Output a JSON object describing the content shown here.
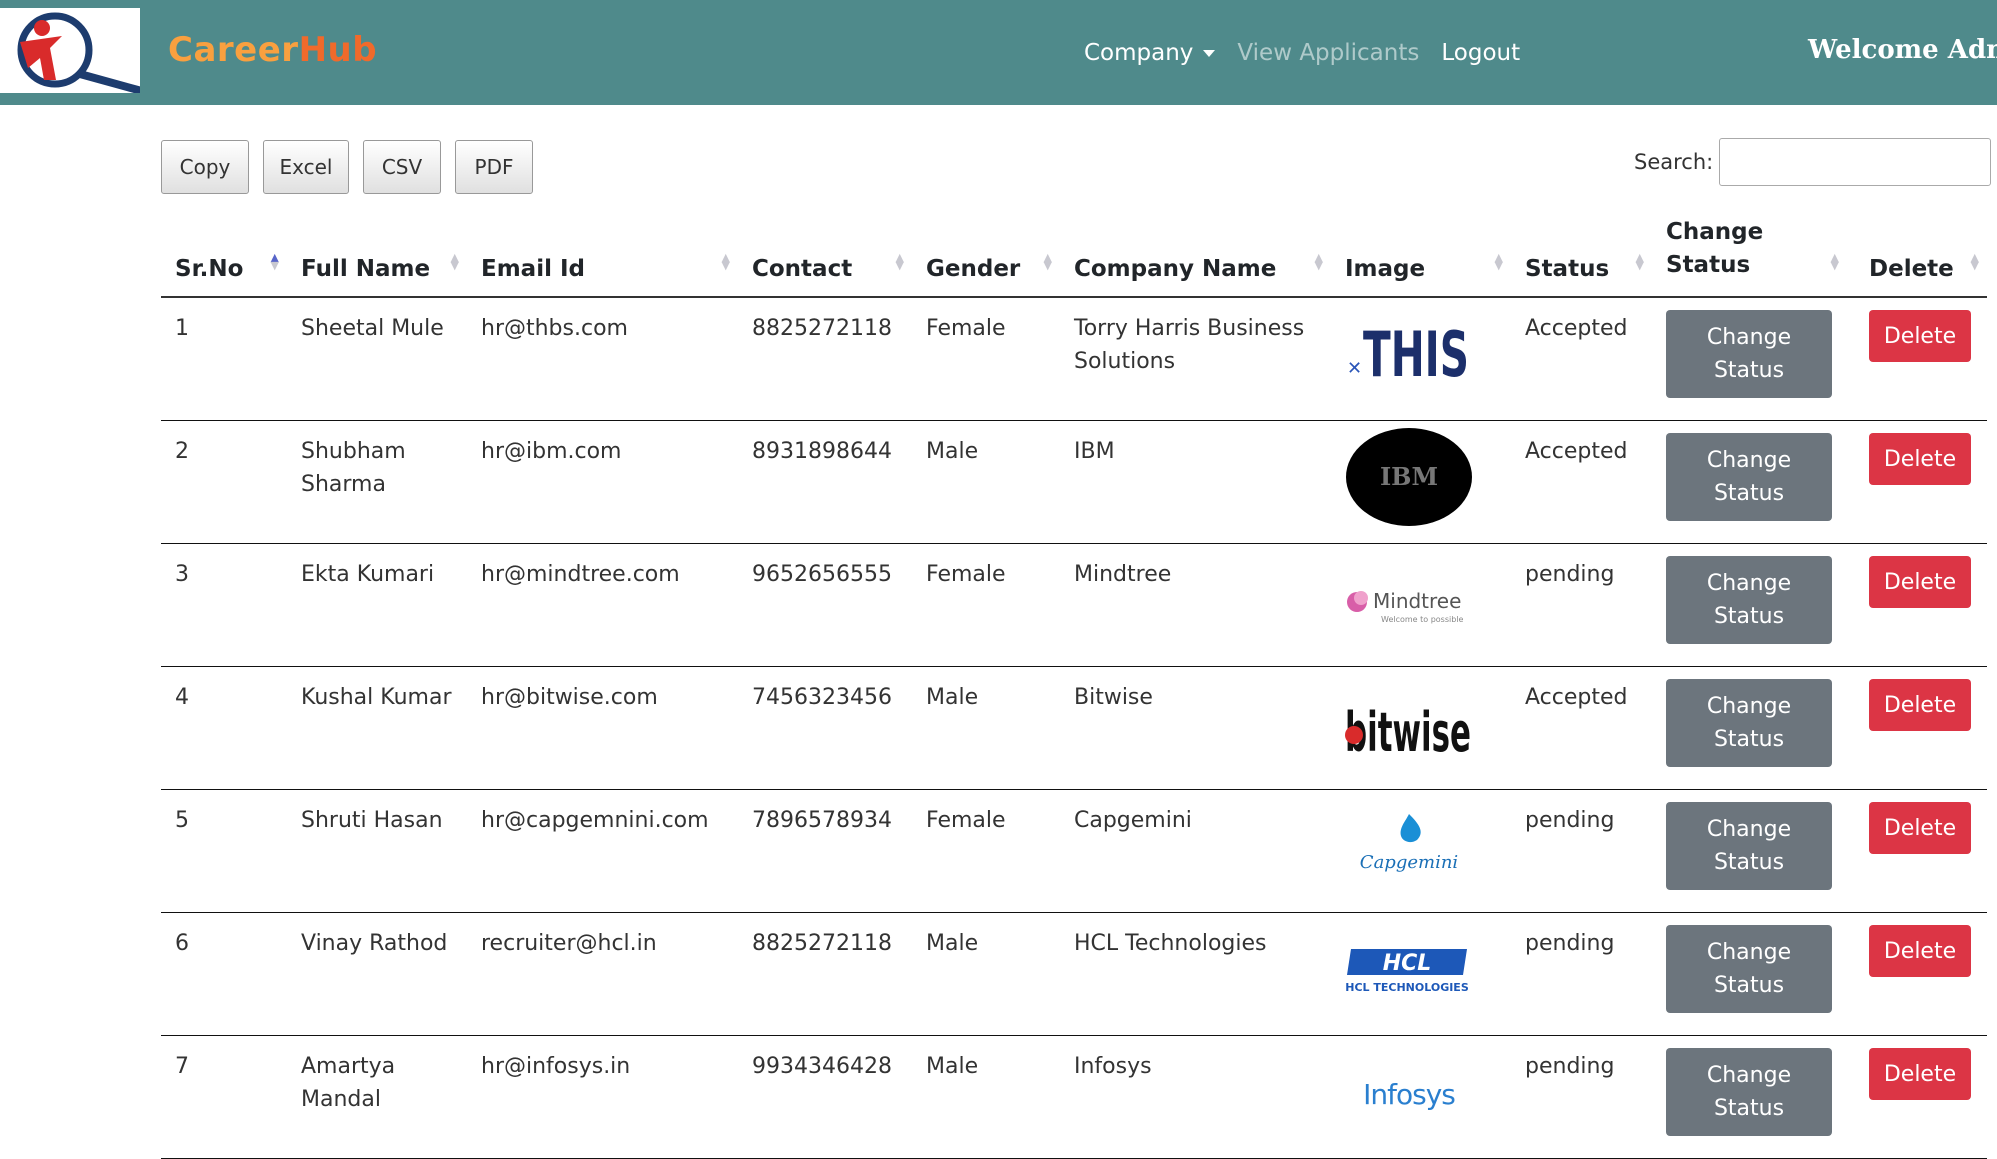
{
  "navbar": {
    "brand_part1": "Career",
    "brand_part2": "Hub",
    "links": [
      "Company",
      "View Applicants",
      "Logout"
    ],
    "welcome": "Welcome Admin"
  },
  "toolbar": {
    "buttons": [
      "Copy",
      "Excel",
      "CSV",
      "PDF"
    ]
  },
  "search": {
    "label": "Search:",
    "value": ""
  },
  "table": {
    "headers": [
      "Sr.No",
      "Full Name",
      "Email Id",
      "Contact",
      "Gender",
      "Company Name",
      "Image",
      "Status",
      "Change Status",
      "Delete"
    ],
    "change_status_label": "Change Status",
    "delete_label": "Delete",
    "rows": [
      {
        "sr": "1",
        "name": "Sheetal Mule",
        "email": "hr@thbs.com",
        "contact": "8825272118",
        "gender": "Female",
        "company": "Torry Harris Business Solutions",
        "logo": "thbs-logo",
        "status": "Accepted"
      },
      {
        "sr": "2",
        "name": "Shubham Sharma",
        "email": "hr@ibm.com",
        "contact": "8931898644",
        "gender": "Male",
        "company": "IBM",
        "logo": "ibm-logo",
        "status": "Accepted"
      },
      {
        "sr": "3",
        "name": "Ekta Kumari",
        "email": "hr@mindtree.com",
        "contact": "9652656555",
        "gender": "Female",
        "company": "Mindtree",
        "logo": "mindtree-logo",
        "status": "pending"
      },
      {
        "sr": "4",
        "name": "Kushal Kumar",
        "email": "hr@bitwise.com",
        "contact": "7456323456",
        "gender": "Male",
        "company": "Bitwise",
        "logo": "bitwise-logo",
        "status": "Accepted"
      },
      {
        "sr": "5",
        "name": "Shruti Hasan",
        "email": "hr@capgemnini.com",
        "contact": "7896578934",
        "gender": "Female",
        "company": "Capgemini",
        "logo": "capgemini-logo",
        "status": "pending"
      },
      {
        "sr": "6",
        "name": "Vinay Rathod",
        "email": "recruiter@hcl.in",
        "contact": "8825272118",
        "gender": "Male",
        "company": "HCL Technologies",
        "logo": "hcl-logo",
        "status": "pending"
      },
      {
        "sr": "7",
        "name": "Amartya Mandal",
        "email": "hr@infosys.in",
        "contact": "9934346428",
        "gender": "Male",
        "company": "Infosys",
        "logo": "infosys-logo",
        "status": "pending"
      }
    ]
  },
  "logo_text": {
    "thbs": "THIS",
    "ibm": "IBM",
    "mindtree": "Mindtree",
    "mindtree_tag": "Welcome to possible",
    "bitwise": "bitwise",
    "capgemini": "Capgemini",
    "hcl": "HCL",
    "hcl_sub": "HCL TECHNOLOGIES",
    "infosys": "Infosys"
  },
  "colors": {
    "navbar": "#4f8a8b",
    "delete": "#dc3545",
    "change_status": "#6c757d"
  }
}
